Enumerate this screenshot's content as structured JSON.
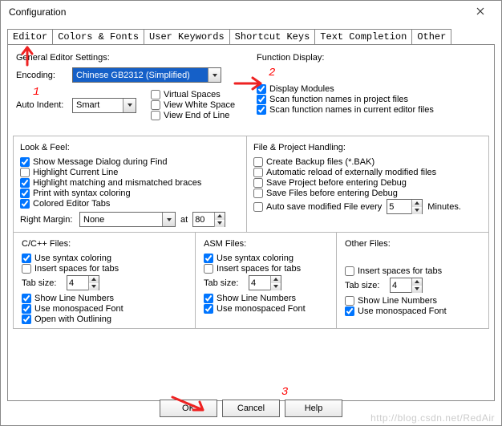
{
  "window": {
    "title": "Configuration"
  },
  "tabs": {
    "items": [
      "Editor",
      "Colors & Fonts",
      "User Keywords",
      "Shortcut Keys",
      "Text Completion",
      "Other"
    ],
    "active": 0
  },
  "annotations": {
    "one": "1",
    "two": "2",
    "three": "3"
  },
  "editor": {
    "general_title": "General Editor Settings:",
    "encoding_label": "Encoding:",
    "encoding_value": "Chinese GB2312 (Simplified)",
    "autoindent_label": "Auto Indent:",
    "autoindent_value": "Smart",
    "virtual_spaces": "Virtual Spaces",
    "view_whitespace": "View White Space",
    "view_eol": "View End of Line",
    "virtual_spaces_checked": false,
    "view_whitespace_checked": false,
    "view_eol_checked": false
  },
  "function_display": {
    "title": "Function Display:",
    "display_modules": "Display Modules",
    "scan_project": "Scan function names in project files",
    "scan_current": "Scan function names in current editor files",
    "display_modules_checked": true,
    "scan_project_checked": true,
    "scan_current_checked": true
  },
  "lookfeel": {
    "title": "Look & Feel:",
    "show_msg": "Show Message Dialog during Find",
    "highlight_line": "Highlight Current Line",
    "highlight_braces": "Highlight matching and mismatched braces",
    "print_syntax": "Print with syntax coloring",
    "colored_tabs": "Colored Editor Tabs",
    "show_msg_checked": true,
    "highlight_line_checked": false,
    "highlight_braces_checked": true,
    "print_syntax_checked": true,
    "colored_tabs_checked": true,
    "right_margin_label": "Right Margin:",
    "right_margin_value": "None",
    "at_label": "at",
    "at_value": "80"
  },
  "file_handling": {
    "title": "File & Project Handling:",
    "backup": "Create Backup files (*.BAK)",
    "autoreload": "Automatic reload of externally modified files",
    "save_proj_debug": "Save Project before entering Debug",
    "save_files_debug": "Save Files before entering Debug",
    "autosave_prefix": "Auto save modified File every",
    "autosave_value": "5",
    "autosave_suffix": "Minutes.",
    "backup_checked": false,
    "autoreload_checked": false,
    "save_proj_debug_checked": false,
    "save_files_debug_checked": false,
    "autosave_checked": false
  },
  "cfiles": {
    "title": "C/C++ Files:",
    "use_syntax": "Use syntax coloring",
    "insert_spaces": "Insert spaces for tabs",
    "tab_size_label": "Tab size:",
    "tab_size_value": "4",
    "show_linenum": "Show Line Numbers",
    "use_mono": "Use monospaced Font",
    "open_outlining": "Open with Outlining",
    "use_syntax_checked": true,
    "insert_spaces_checked": false,
    "show_linenum_checked": true,
    "use_mono_checked": true,
    "open_outlining_checked": true
  },
  "asmfiles": {
    "title": "ASM Files:",
    "use_syntax": "Use syntax coloring",
    "insert_spaces": "Insert spaces for tabs",
    "tab_size_label": "Tab size:",
    "tab_size_value": "4",
    "show_linenum": "Show Line Numbers",
    "use_mono": "Use monospaced Font",
    "use_syntax_checked": true,
    "insert_spaces_checked": false,
    "show_linenum_checked": true,
    "use_mono_checked": true
  },
  "otherfiles": {
    "title": "Other Files:",
    "insert_spaces": "Insert spaces for tabs",
    "tab_size_label": "Tab size:",
    "tab_size_value": "4",
    "show_linenum": "Show Line Numbers",
    "use_mono": "Use monospaced Font",
    "insert_spaces_checked": false,
    "show_linenum_checked": false,
    "use_mono_checked": true
  },
  "buttons": {
    "ok": "OK",
    "cancel": "Cancel",
    "help": "Help"
  },
  "watermark": "http://blog.csdn.net/RedAir"
}
